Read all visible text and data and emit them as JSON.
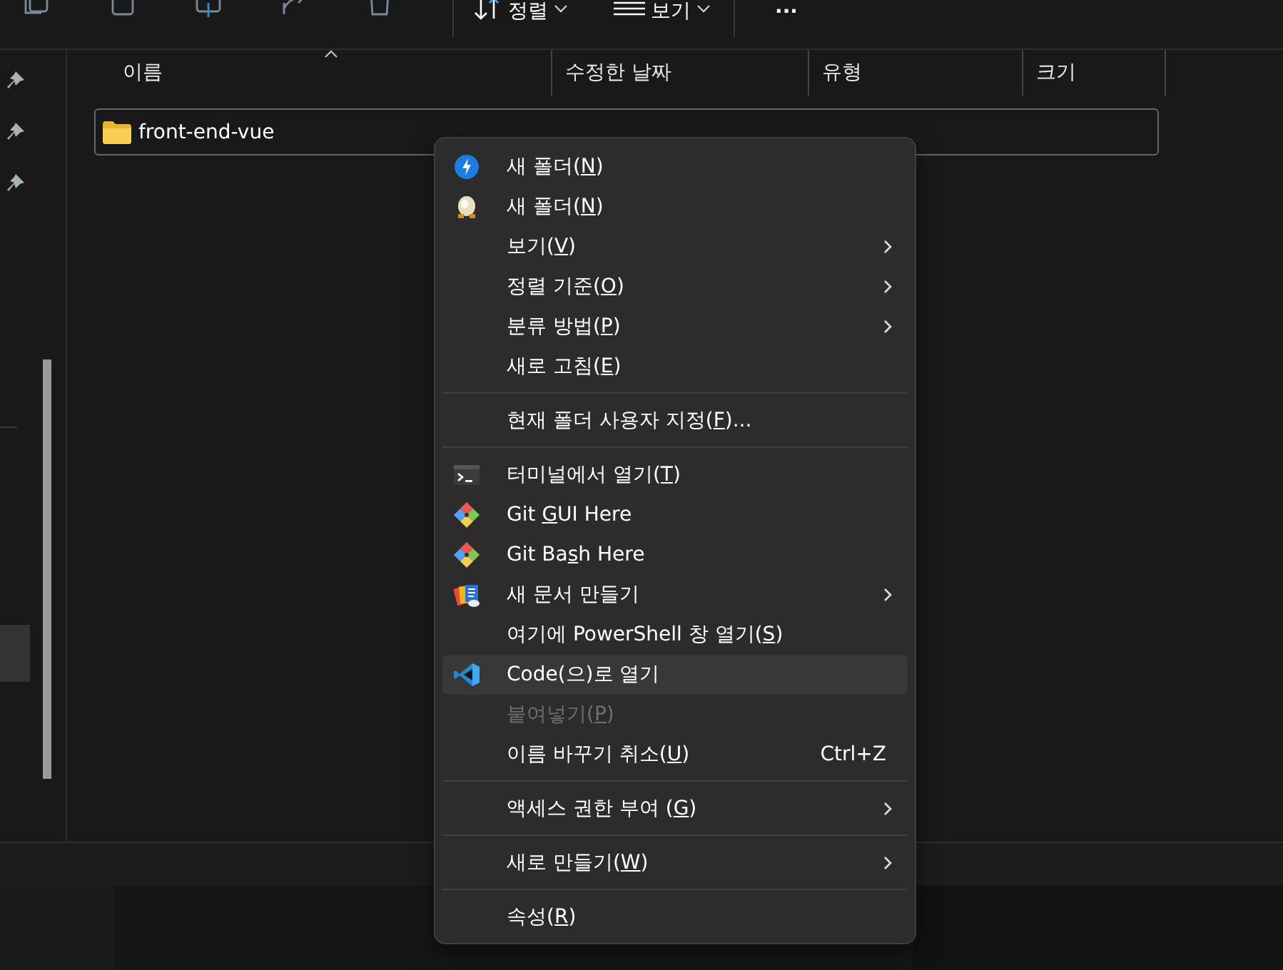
{
  "toolbar": {
    "sort_label": "정렬",
    "view_label": "보기",
    "more": "..."
  },
  "columns": [
    {
      "label": "이름",
      "sorted": true
    },
    {
      "label": "수정한 날짜",
      "sorted": false
    },
    {
      "label": "유형",
      "sorted": false
    },
    {
      "label": "크기",
      "sorted": false
    }
  ],
  "rows": [
    {
      "name": "front-end-vue",
      "selected": true
    }
  ],
  "context_menu": {
    "items": [
      {
        "kind": "item",
        "label": "새 폴더(",
        "access_key": "N",
        "label_after": ")",
        "submenu": false,
        "disabled": false,
        "selected": false
      },
      {
        "kind": "item",
        "label": "새 폴더(",
        "access_key": "N",
        "label_after": ")",
        "submenu": false,
        "disabled": false,
        "selected": false
      },
      {
        "kind": "item",
        "label": "보기(",
        "access_key": "V",
        "label_after": ")",
        "submenu": true,
        "disabled": false,
        "selected": false
      },
      {
        "kind": "item",
        "label": "정렬 기준(",
        "access_key": "O",
        "label_after": ")",
        "submenu": true,
        "disabled": false,
        "selected": false
      },
      {
        "kind": "item",
        "label": "분류 방법(",
        "access_key": "P",
        "label_after": ")",
        "submenu": true,
        "disabled": false,
        "selected": false
      },
      {
        "kind": "item",
        "label": "새로 고침(",
        "access_key": "E",
        "label_after": ")",
        "submenu": false,
        "disabled": false,
        "selected": false
      },
      {
        "kind": "separator"
      },
      {
        "kind": "item",
        "label": "현재 폴더 사용자 지정(",
        "access_key": "F",
        "label_after": ")...",
        "submenu": false,
        "disabled": false,
        "selected": false
      },
      {
        "kind": "separator"
      },
      {
        "kind": "item",
        "label": "터미널에서 열기(",
        "access_key": "T",
        "label_after": ")",
        "submenu": false,
        "disabled": false,
        "selected": false
      },
      {
        "kind": "item",
        "label": "Git ",
        "access_key": "G",
        "label_after": "UI Here",
        "submenu": false,
        "disabled": false,
        "selected": false
      },
      {
        "kind": "item",
        "label": "Git Ba",
        "access_key": "s",
        "label_after": "h Here",
        "submenu": false,
        "disabled": false,
        "selected": false
      },
      {
        "kind": "item",
        "label": "새 문서 만들기",
        "submenu": true,
        "disabled": false,
        "selected": false
      },
      {
        "kind": "item",
        "label": "여기에 PowerShell 창 열기(",
        "access_key": "S",
        "label_after": ")",
        "submenu": false,
        "disabled": false,
        "selected": false
      },
      {
        "kind": "item",
        "label": "Code(으)로 열기",
        "submenu": false,
        "disabled": false,
        "selected": true
      },
      {
        "kind": "item",
        "label": "붙여넣기(",
        "access_key": "P",
        "label_after": ")",
        "submenu": false,
        "disabled": true,
        "selected": false
      },
      {
        "kind": "item",
        "label": "이름 바꾸기 취소(",
        "access_key": "U",
        "label_after": ")",
        "shortcut": "Ctrl+Z",
        "submenu": false,
        "disabled": false,
        "selected": false
      },
      {
        "kind": "separator"
      },
      {
        "kind": "item",
        "label": "액세스 권한 부여 (",
        "access_key": "G",
        "label_after": ")",
        "submenu": true,
        "disabled": false,
        "selected": false
      },
      {
        "kind": "separator"
      },
      {
        "kind": "item",
        "label": "새로 만들기(",
        "access_key": "W",
        "label_after": ")",
        "submenu": true,
        "disabled": false,
        "selected": false
      },
      {
        "kind": "separator"
      },
      {
        "kind": "item",
        "label": "속성(",
        "access_key": "R",
        "label_after": ")",
        "submenu": false,
        "disabled": false,
        "selected": false
      }
    ]
  }
}
